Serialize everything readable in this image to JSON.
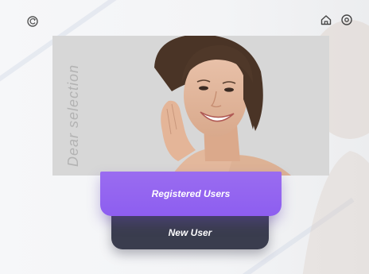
{
  "header": {
    "back_icon": "back-refresh-icon",
    "home_icon": "home-icon",
    "settings_icon": "settings-icon"
  },
  "hero": {
    "vertical_text": "Dear selection",
    "image": "smiling-woman-portrait"
  },
  "actions": {
    "registered_label": "Registered Users",
    "new_user_label": "New User"
  },
  "colors": {
    "primary_button": "#8d5ef0",
    "secondary_button": "#3a3d4e",
    "background": "#f4f5f7"
  }
}
